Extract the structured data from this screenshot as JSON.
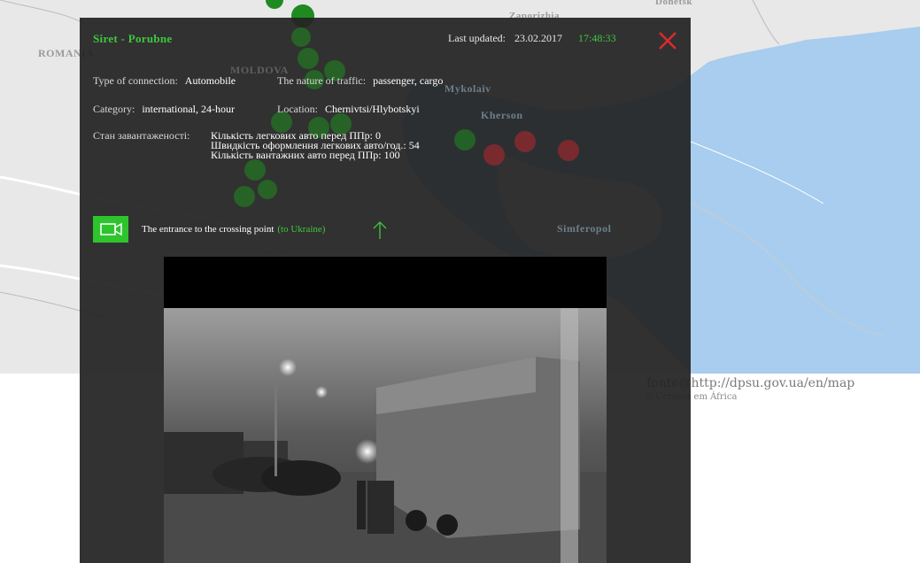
{
  "map": {
    "labels": {
      "romania": "ROMANIA",
      "moldova": "MOLDOVA",
      "zaporizhia": "Zaporizhia",
      "donetsk": "Donetsk",
      "mykolaiv": "Mykolaiv",
      "kherson": "Kherson",
      "simferopol": "Simferopol"
    },
    "colors": {
      "land": "#e8e8e8",
      "sea": "#a8cdee",
      "border": "#ffffff",
      "marker_green": "#1f8a1f",
      "marker_red": "#b8262c"
    }
  },
  "credit": {
    "source": "fonte@http://dpsu.gov.ua/en/map",
    "author": "@Ucrânia em África"
  },
  "panel": {
    "title": "Siret - Porubne",
    "last_updated_label": "Last updated:",
    "date": "23.02.2017",
    "time": "17:48:33",
    "close_icon": "close-icon",
    "fields": {
      "connection_label": "Type of connection:",
      "connection_value": "Automobile",
      "traffic_label": "The nature of traffic:",
      "traffic_value": "passenger, cargo",
      "category_label": "Category:",
      "category_value": "international, 24-hour",
      "location_label": "Location:",
      "location_value": "Chernivtsi/Hlybotskyi"
    },
    "status": {
      "label": "Стан завантаженості:",
      "line1": "Кількість легкових авто перед ППр: 0",
      "line2": "Швидкість оформлення легкових авто/год.: 54",
      "line3": "Кількість вантажних авто перед ППр: 100"
    },
    "camera": {
      "icon": "video-camera-icon",
      "label": "The entrance to the crossing point",
      "direction": "(to Ukraine)",
      "arrow_icon": "arrow-up-icon"
    },
    "accent": "#3ec83e"
  }
}
